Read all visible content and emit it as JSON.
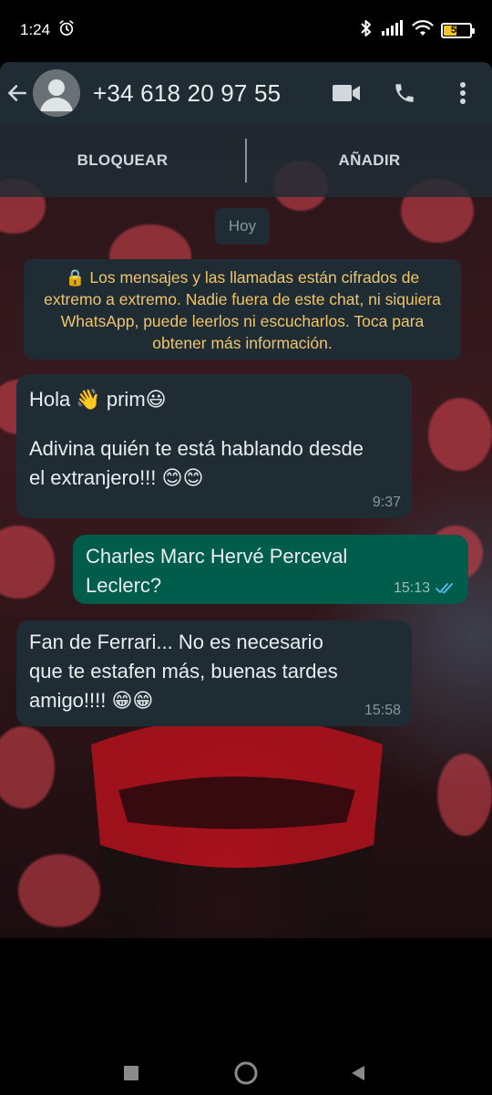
{
  "status_bar": {
    "time": "1:24",
    "battery_level": "54",
    "battery_color": "#f3c321"
  },
  "header": {
    "contact_name": "+34 618 20 97 55",
    "icons": [
      "back-arrow-icon",
      "avatar",
      "video-call-icon",
      "phone-icon",
      "more-vert-icon"
    ]
  },
  "actions": {
    "block_label": "BLOQUEAR",
    "add_label": "AÑADIR"
  },
  "chat": {
    "date_chip": "Hoy",
    "encryption_notice": "🔒 Los mensajes y las llamadas están cifrados de extremo a extremo. Nadie fuera de este chat, ni siquiera WhatsApp, puede leerlos ni escucharlos. Toca para obtener más información.",
    "messages": [
      {
        "direction": "in",
        "line1": "Hola 👋 prim😃",
        "line2": "Adivina quién te está hablando desde",
        "line3": "el extranjero!!! 😊😊",
        "time": "9:37"
      },
      {
        "direction": "out",
        "line1": "Charles Marc Hervé Perceval",
        "line2": "Leclerc?",
        "time": "15:13",
        "status": "read"
      },
      {
        "direction": "in",
        "line1": "Fan de Ferrari... No es necesario",
        "line2": "que te estafen más, buenas tardes",
        "line3": "amigo!!!! 😁😁",
        "time": "15:58"
      }
    ]
  },
  "colors": {
    "bubble_in": "#1f2c34",
    "bubble_out": "#005c4b",
    "read_ticks": "#53bdeb",
    "encryption_text": "#f0c56a"
  }
}
